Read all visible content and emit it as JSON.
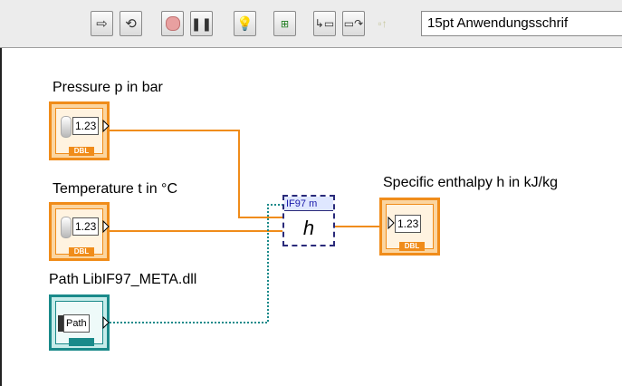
{
  "toolbar": {
    "buttons": [
      {
        "name": "run-button",
        "icon": "run-arrow-icon"
      },
      {
        "name": "run-continuously-button",
        "icon": "run-continuously-icon"
      },
      {
        "name": "abort-button",
        "icon": "stop-icon"
      },
      {
        "name": "pause-button",
        "icon": "pause-icon"
      },
      {
        "name": "highlight-execution-button",
        "icon": "lightbulb-icon"
      },
      {
        "name": "retain-wire-values-button",
        "icon": "probe-icon"
      },
      {
        "name": "step-into-button",
        "icon": "step-into-icon"
      },
      {
        "name": "step-over-button",
        "icon": "step-over-icon"
      },
      {
        "name": "step-out-button",
        "icon": "step-out-icon"
      }
    ],
    "font_selector": "15pt Anwendungsschrif"
  },
  "diagram": {
    "pressure": {
      "label": "Pressure p in bar",
      "value": "1.23",
      "type": "DBL"
    },
    "temperature": {
      "label": "Temperature t in °C",
      "value": "1.23",
      "type": "DBL"
    },
    "path": {
      "label": "Path LibIF97_META.dll",
      "value": "Path"
    },
    "subvi": {
      "title": "IF97 m",
      "symbol": "h"
    },
    "enthalpy": {
      "label": "Specific enthalpy h in kJ/kg",
      "value": "1.23",
      "type": "DBL"
    }
  },
  "colors": {
    "dbl_wire": "#f08c1a",
    "path_wire": "#1a8a8a",
    "subvi_border": "#2a2a7a"
  }
}
